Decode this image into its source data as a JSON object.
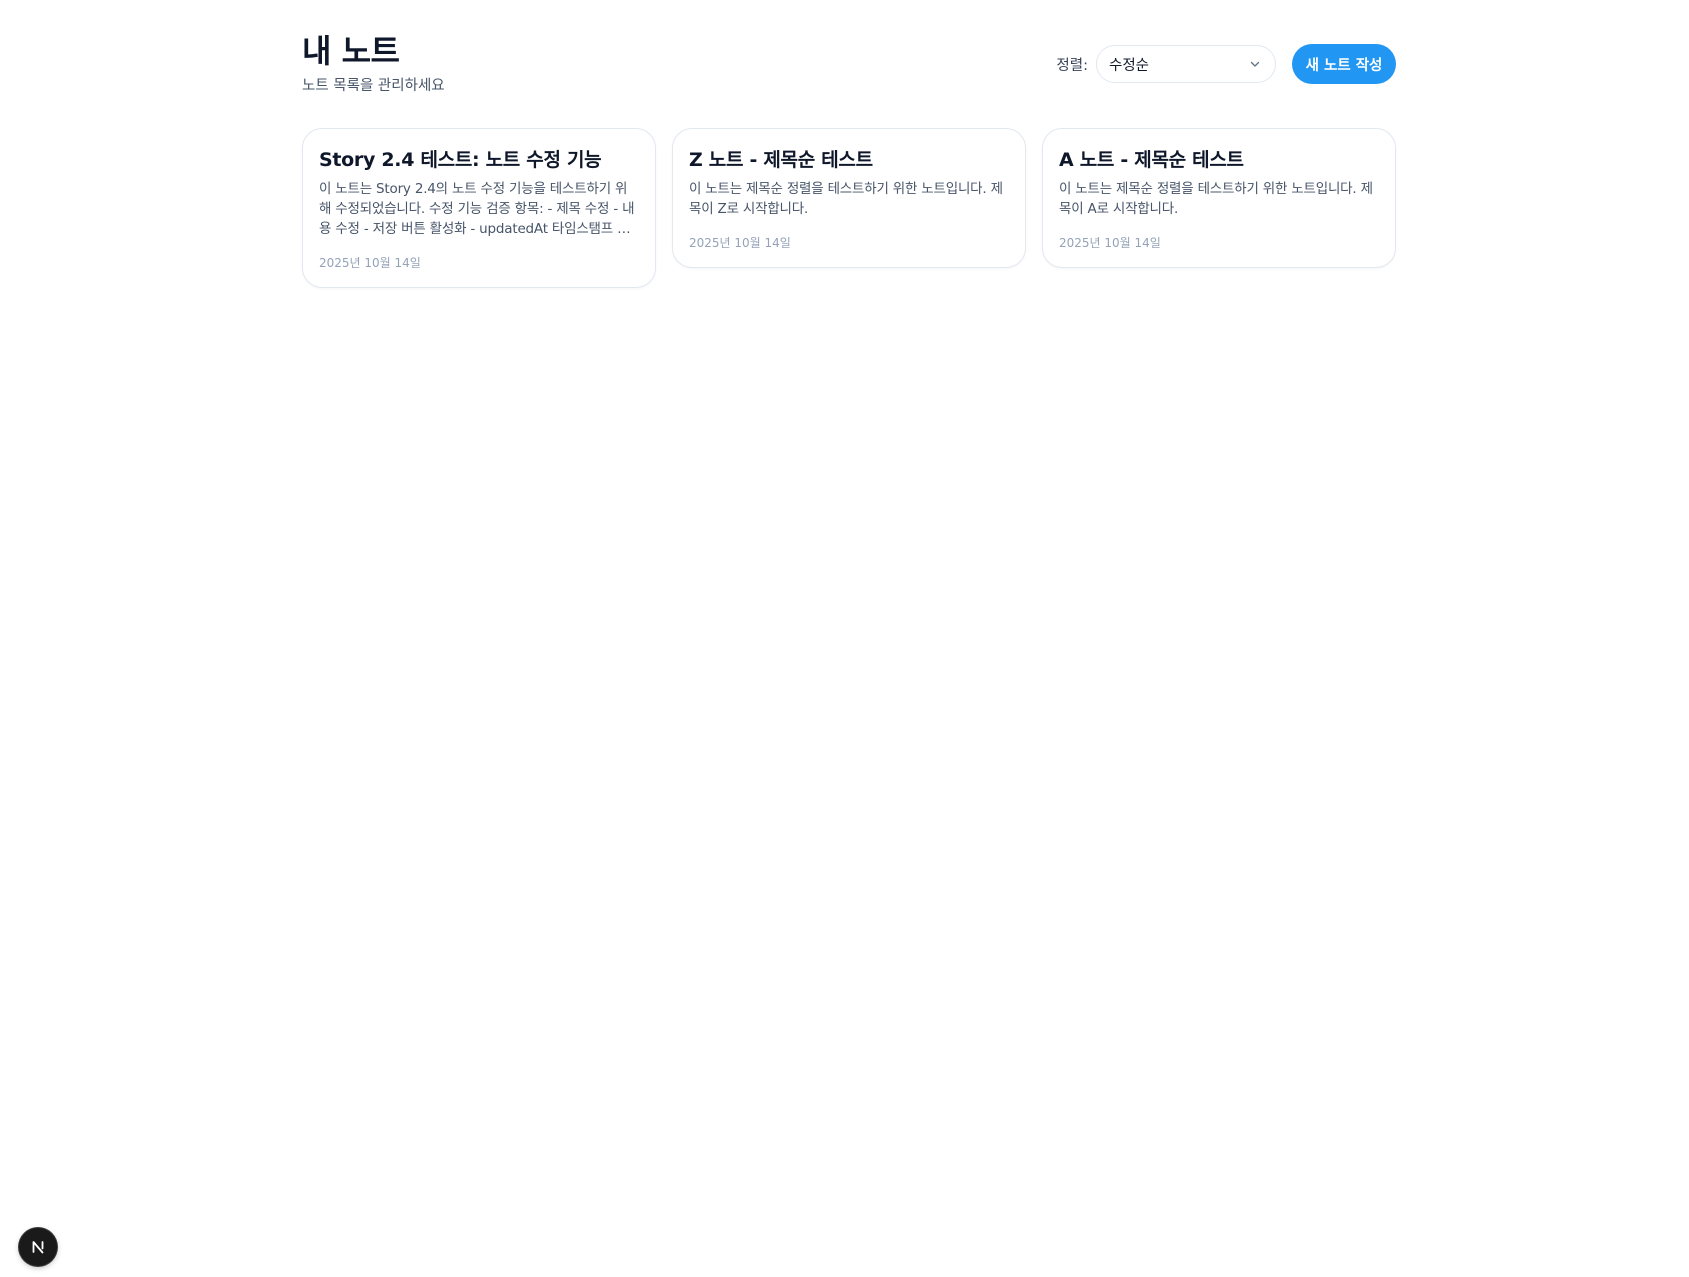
{
  "header": {
    "title": "내 노트",
    "subtitle": "노트 목록을 관리하세요"
  },
  "sort": {
    "label": "정렬:",
    "selected": "수정순",
    "icon": "chevron-down-icon"
  },
  "actions": {
    "new_note_label": "새 노트 작성",
    "accent_color": "#2196f3"
  },
  "notes": [
    {
      "title": "Story 2.4 테스트: 노트 수정 기능",
      "content": "이 노트는 Story 2.4의 노트 수정 기능을 테스트하기 위해 수정되었습니다. 수정 기능 검증 항목: - 제목 수정 - 내용 수정 - 저장 버튼 활성화 - updatedAt 타임스탬프 갱신",
      "date": "2025년 10월 14일"
    },
    {
      "title": "Z 노트 - 제목순 테스트",
      "content": "이 노트는 제목순 정렬을 테스트하기 위한 노트입니다. 제목이 Z로 시작합니다.",
      "date": "2025년 10월 14일"
    },
    {
      "title": "A 노트 - 제목순 테스트",
      "content": "이 노트는 제목순 정렬을 테스트하기 위한 노트입니다. 제목이 A로 시작합니다.",
      "date": "2025년 10월 14일"
    }
  ],
  "dev_indicator": {
    "icon": "nextjs-logo-icon"
  }
}
